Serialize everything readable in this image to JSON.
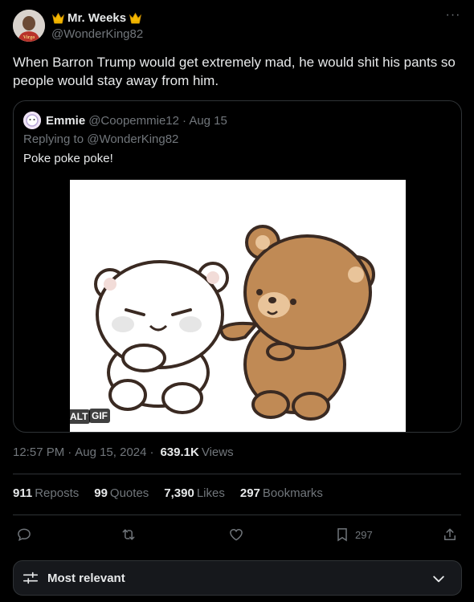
{
  "author": {
    "name": "Mr. Weeks",
    "handle": "@WonderKing82",
    "avatar_text": "Virgo"
  },
  "tweet": {
    "text": "When Barron Trump would get extremely mad, he would shit his pants so people would stay away from him."
  },
  "quote": {
    "name": "Emmie",
    "handle": "@Coopemmie12",
    "date": "· Aug 15",
    "replying_to": "Replying to @WonderKing82",
    "text": "Poke poke poke!",
    "gif_label": "GIF",
    "alt_label": "ALT"
  },
  "meta": {
    "time": "12:57 PM",
    "date": "Aug 15, 2024",
    "views_count": "639.1K",
    "views_label": "Views"
  },
  "stats": {
    "reposts_count": "911",
    "reposts_label": "Reposts",
    "quotes_count": "99",
    "quotes_label": "Quotes",
    "likes_count": "7,390",
    "likes_label": "Likes",
    "bookmarks_count": "297",
    "bookmarks_label": "Bookmarks"
  },
  "actions": {
    "bookmark_count": "297"
  },
  "sort": {
    "label": "Most relevant"
  },
  "colors": {
    "background": "#000000",
    "text": "#e7e9ea",
    "secondary": "#71767b",
    "border": "#2f3336",
    "crown": "#f5b800"
  }
}
